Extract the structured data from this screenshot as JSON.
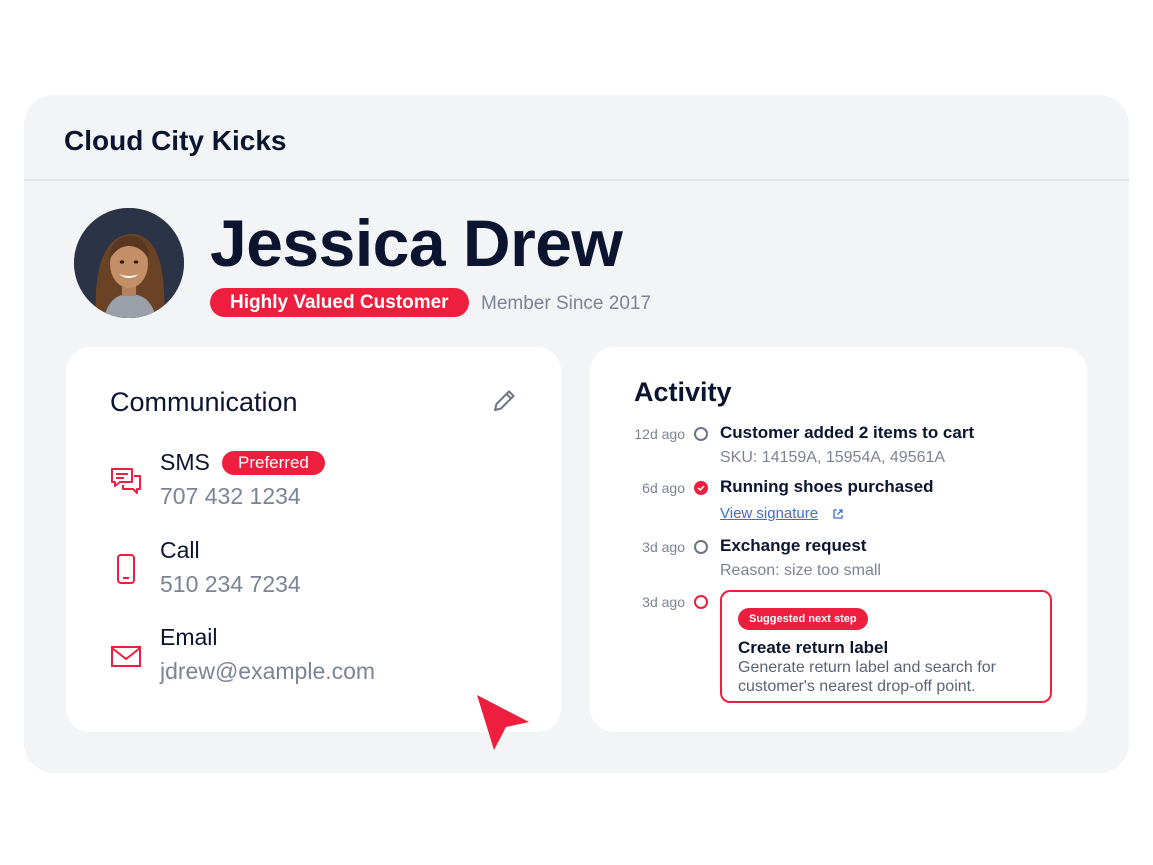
{
  "app": {
    "title": "Cloud City Kicks"
  },
  "customer": {
    "name": "Jessica Drew",
    "status_badge": "Highly Valued Customer",
    "member_since": "Member Since 2017"
  },
  "communication": {
    "title": "Communication",
    "channels": [
      {
        "label": "SMS",
        "badge": "Preferred",
        "value": "707 432 1234",
        "icon": "chat-bubbles-icon"
      },
      {
        "label": "Call",
        "value": "510 234 7234",
        "icon": "mobile-phone-icon"
      },
      {
        "label": "Email",
        "value": "jdrew@example.com",
        "icon": "envelope-icon"
      }
    ]
  },
  "activity": {
    "title": "Activity",
    "items": [
      {
        "time": "12d ago",
        "title": "Customer added 2 items to cart",
        "sub": "SKU: 14159A, 15954A, 49561A",
        "state": "open"
      },
      {
        "time": "6d ago",
        "title": "Running shoes purchased",
        "link": "View signature",
        "state": "done"
      },
      {
        "time": "3d ago",
        "title": "Exchange request",
        "sub": "Reason: size too small",
        "state": "open"
      },
      {
        "time": "3d ago",
        "state": "next"
      }
    ],
    "next_step": {
      "badge": "Suggested next step",
      "title": "Create return label",
      "description": "Generate return label and search for customer's nearest drop-off point."
    }
  },
  "colors": {
    "accent": "#ee1f3e",
    "heading": "#0b1530",
    "muted": "#7b8395",
    "link": "#3a6fd8",
    "panel": "#f3f4f6"
  }
}
